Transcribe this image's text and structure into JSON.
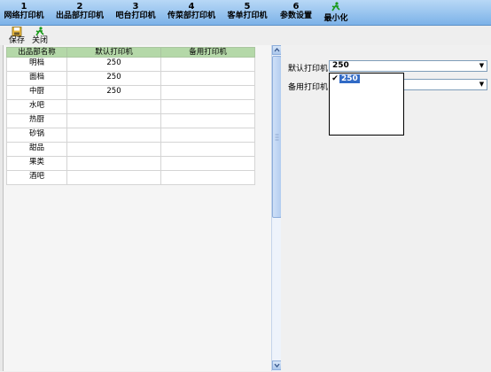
{
  "tabs": [
    {
      "num": "1",
      "label": "网络打印机"
    },
    {
      "num": "2",
      "label": "出品部打印机"
    },
    {
      "num": "3",
      "label": "吧台打印机"
    },
    {
      "num": "4",
      "label": "传菜部打印机"
    },
    {
      "num": "5",
      "label": "客单打印机"
    },
    {
      "num": "6",
      "label": "参数设置"
    },
    {
      "label": "最小化",
      "icon": "runner-icon"
    }
  ],
  "toolbar": {
    "save_label": "保存",
    "close_label": "关闭"
  },
  "grid": {
    "headers": [
      "出品部名称",
      "默认打印机",
      "备用打印机"
    ],
    "rows": [
      [
        "明档",
        "250",
        ""
      ],
      [
        "面档",
        "250",
        ""
      ],
      [
        "中厨",
        "250",
        ""
      ],
      [
        "水吧",
        "",
        ""
      ],
      [
        "热厨",
        "",
        ""
      ],
      [
        "砂锅",
        "",
        ""
      ],
      [
        "甜品",
        "",
        ""
      ],
      [
        "果类",
        "",
        ""
      ],
      [
        "酒吧",
        "",
        ""
      ]
    ]
  },
  "form": {
    "default_printer_label": "默认打印机",
    "default_printer_value": "250",
    "backup_printer_label": "备用打印机",
    "backup_printer_value": "",
    "dropdown_options": [
      "250"
    ],
    "dropdown_selected": "250"
  },
  "colors": {
    "topbar": "#7cb2e8",
    "grid_header": "#b4d8a8",
    "selection": "#316ac5"
  }
}
